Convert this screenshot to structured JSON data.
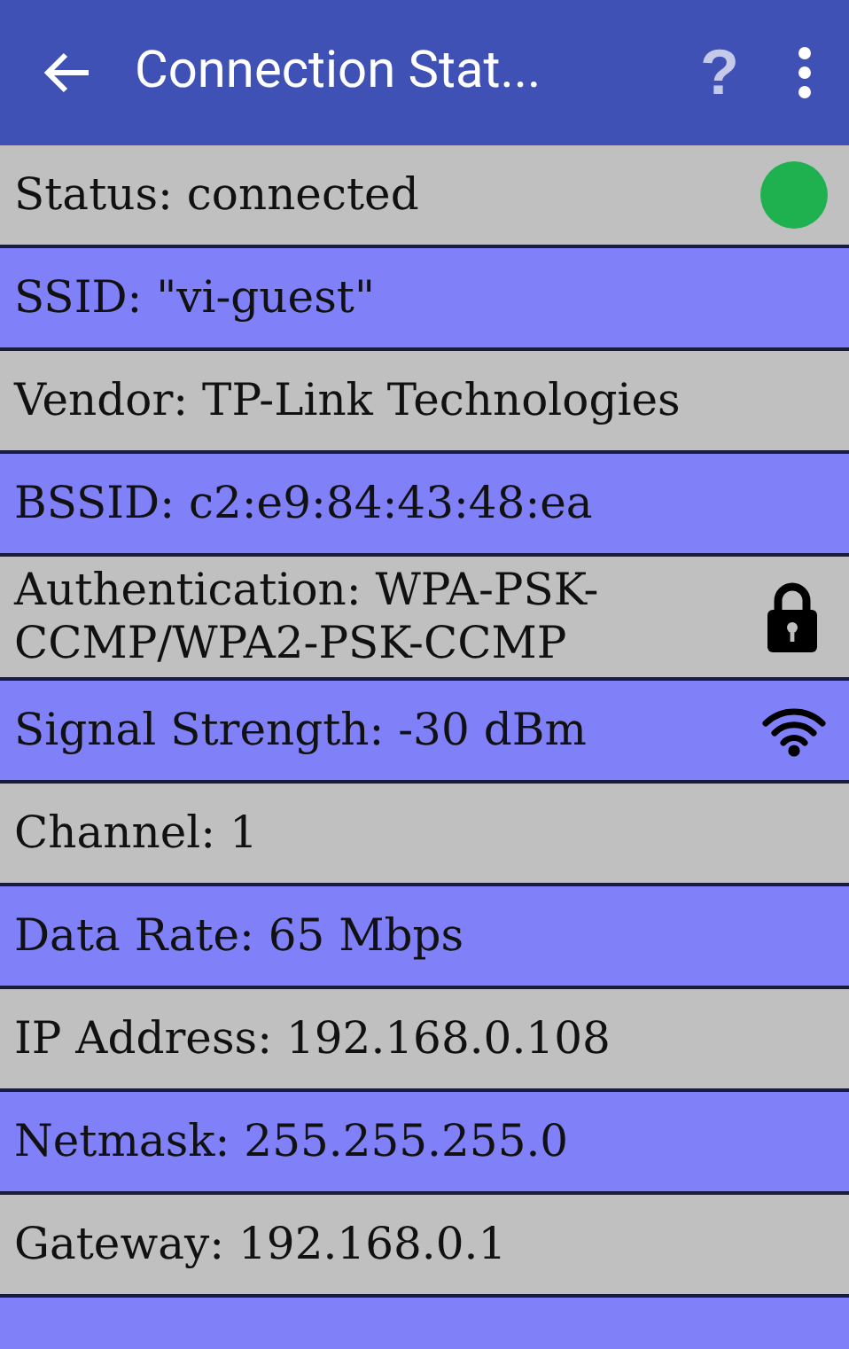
{
  "app_bar": {
    "title": "Connection Stat...",
    "help": "?"
  },
  "rows": [
    {
      "text": "Status: connected",
      "kind": "dot",
      "color": "#1fb14f"
    },
    {
      "text": "SSID: \"vi-guest\""
    },
    {
      "text": "Vendor: TP-Link Technologies"
    },
    {
      "text": "BSSID: c2:e9:84:43:48:ea"
    },
    {
      "text": "Authentication: WPA-PSK-CCMP/WPA2-PSK-CCMP",
      "kind": "lock"
    },
    {
      "text": "Signal Strength: -30 dBm",
      "kind": "wifi"
    },
    {
      "text": "Channel: 1"
    },
    {
      "text": "Data Rate: 65 Mbps"
    },
    {
      "text": "IP Address: 192.168.0.108"
    },
    {
      "text": "Netmask: 255.255.255.0"
    },
    {
      "text": "Gateway: 192.168.0.1"
    }
  ]
}
